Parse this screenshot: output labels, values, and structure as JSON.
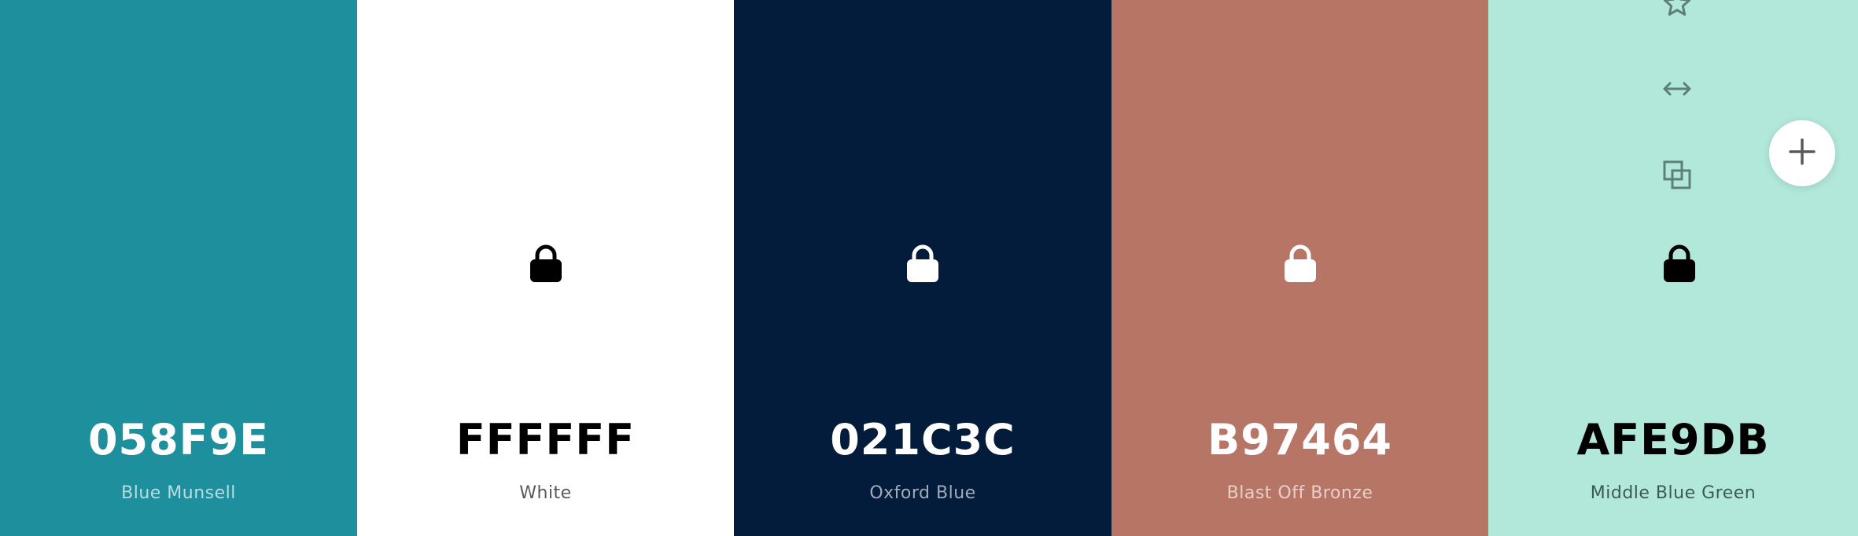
{
  "swatches": [
    {
      "hex": "058F9E",
      "name": "Blue Munsell",
      "bg": "#1e8f9c",
      "hex_color": "#ffffff",
      "name_color": "#b7dde2",
      "lock_color": null
    },
    {
      "hex": "FFFFFF",
      "name": "White",
      "bg": "#ffffff",
      "hex_color": "#000000",
      "name_color": "#5a5a5a",
      "lock_color": "#000000"
    },
    {
      "hex": "021C3C",
      "name": "Oxford Blue",
      "bg": "#031c3c",
      "hex_color": "#ffffff",
      "name_color": "#a2acb9",
      "lock_color": "#ffffff"
    },
    {
      "hex": "B97464",
      "name": "Blast Off Bronze",
      "bg": "#b77565",
      "hex_color": "#ffffff",
      "name_color": "#e8cfc8",
      "lock_color": "#ffffff"
    },
    {
      "hex": "AFE9DB",
      "name": "Middle Blue Green",
      "bg": "#b1e8da",
      "hex_color": "#000000",
      "name_color": "#3c5a55",
      "lock_color": "#000000"
    }
  ],
  "hover_tools": {
    "icons": [
      "star-icon",
      "drag-arrows-icon",
      "copy-icon"
    ],
    "color": "#5e7f78"
  },
  "add_button": {
    "icon": "plus-icon",
    "color": "#5a5a5a"
  }
}
